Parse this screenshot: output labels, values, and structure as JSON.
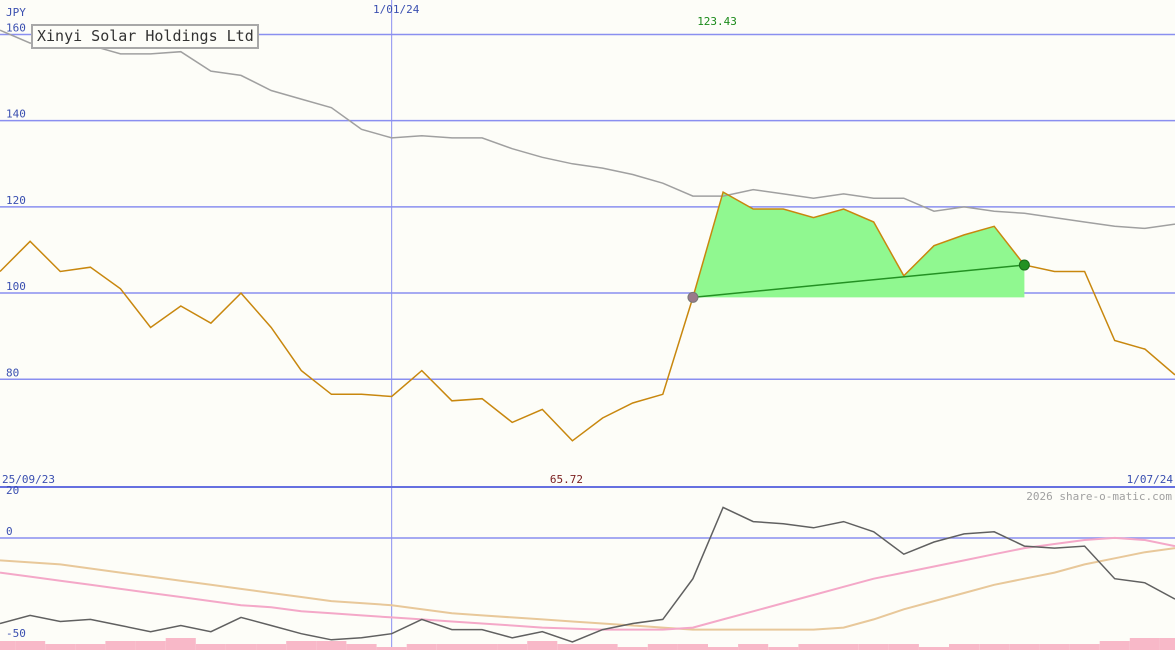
{
  "title": "Xinyi Solar Holdings Ltd",
  "credit": "2026 share-o-matic.com",
  "chart_data": {
    "type": "line",
    "currency_label": "JPY",
    "x_start_label": "25/09/23",
    "x_end_label": "1/07/24",
    "x_marker_label": "1/01/24",
    "x_count": 40,
    "x_marker_index": 13,
    "y_ticks": [
      80,
      100,
      120,
      140,
      160
    ],
    "ylim": [
      55,
      168
    ],
    "high": {
      "label": "123.43",
      "index": 24,
      "value": 123.43
    },
    "low": {
      "label": "65.72",
      "index": 19,
      "value": 65.72
    },
    "price": [
      105,
      112,
      105,
      106,
      101,
      92,
      97,
      93,
      100,
      92,
      82,
      76.5,
      76.5,
      76,
      82,
      75,
      75.5,
      70,
      73,
      65.72,
      71,
      74.5,
      76.5,
      99,
      123.43,
      119.5,
      119.5,
      117.5,
      119.5,
      116.5,
      104,
      111,
      113.5,
      115.5,
      106.5,
      105,
      105,
      89,
      87,
      81
    ],
    "moving_average": [
      161,
      158,
      158.5,
      157.5,
      155.5,
      155.5,
      156,
      151.5,
      150.5,
      147,
      145,
      143,
      138,
      136,
      136.5,
      136,
      136,
      133.5,
      131.5,
      130,
      129,
      127.5,
      125.5,
      122.5,
      122.5,
      124,
      123,
      122,
      123,
      122,
      122,
      119,
      120,
      119,
      118.5,
      117.5,
      116.5,
      115.5,
      115,
      116
    ],
    "trade": {
      "start_index": 23,
      "start_value": 99,
      "end_index": 34,
      "end_value": 106.5
    },
    "indicator": {
      "y_ticks": [
        20,
        0,
        -50
      ],
      "ylim": [
        -55,
        25
      ],
      "oscillator": [
        -42,
        -38,
        -41,
        -40,
        -43,
        -46,
        -43,
        -46,
        -39,
        -43,
        -47,
        -50,
        -49,
        -47,
        -40,
        -45,
        -45,
        -49,
        -46,
        -51,
        -45,
        -42,
        -40,
        -20,
        15,
        8,
        7,
        5,
        8,
        3,
        -8,
        -2,
        2,
        3,
        -4,
        -5,
        -4,
        -20,
        -22,
        -30
      ],
      "signal_pink": [
        -17,
        -19,
        -21,
        -23,
        -25,
        -27,
        -29,
        -31,
        -33,
        -34,
        -36,
        -37,
        -38,
        -39,
        -40,
        -41,
        -42,
        -43,
        -44,
        -44.5,
        -45,
        -45,
        -45,
        -44,
        -40,
        -36,
        -32,
        -28,
        -24,
        -20,
        -17,
        -14,
        -11,
        -8,
        -5,
        -3,
        -1,
        0,
        -1,
        -4
      ],
      "signal_tan": [
        -11,
        -12,
        -13,
        -15,
        -17,
        -19,
        -21,
        -23,
        -25,
        -27,
        -29,
        -31,
        -32,
        -33,
        -35,
        -37,
        -38,
        -39,
        -40,
        -41,
        -42,
        -43,
        -44,
        -45,
        -45,
        -45,
        -45,
        -45,
        -44,
        -40,
        -35,
        -31,
        -27,
        -23,
        -20,
        -17,
        -13,
        -10,
        -7,
        -5
      ]
    },
    "volume": [
      3,
      3,
      2,
      2,
      3,
      3,
      4,
      2,
      2,
      2,
      3,
      3,
      2,
      1,
      2,
      2,
      2,
      2,
      3,
      2,
      2,
      1,
      2,
      2,
      1,
      2,
      1,
      2,
      2,
      2,
      2,
      1,
      2,
      2,
      2,
      2,
      2,
      3,
      4,
      4
    ],
    "colors": {
      "price": "#c8870e",
      "moving_average": "#a0a0a0",
      "grid": "#8a8ff0",
      "trade_fill": "#90f890",
      "trade_line": "#239123",
      "oscillator": "#606060",
      "signal_pink": "#f4a8c8",
      "signal_tan": "#e8c89a",
      "volume": "#f8b8c8"
    }
  }
}
